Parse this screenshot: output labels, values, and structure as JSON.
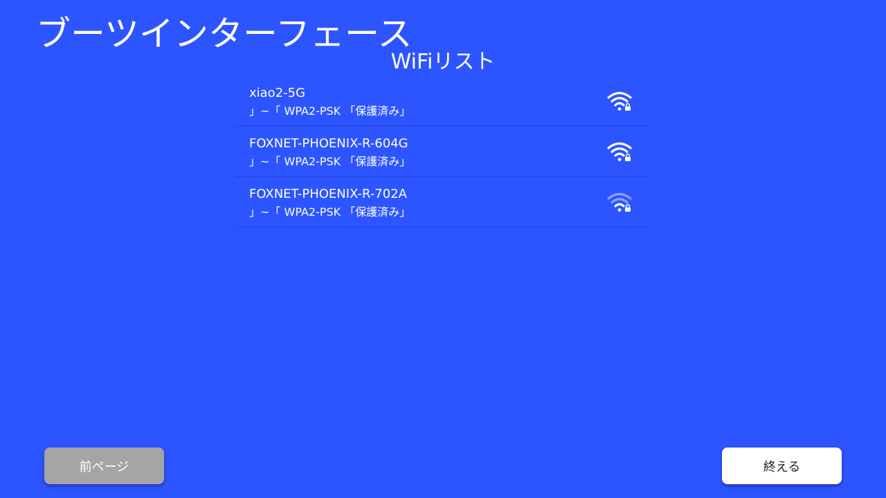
{
  "header": {
    "title": "ブーツインターフェース"
  },
  "wifi_section": {
    "title": "WiFiリスト"
  },
  "networks": [
    {
      "ssid": "xiao2-5G",
      "security": "」~「 WPA2-PSK 「保護済み」",
      "signal_icon": "wifi-signal-full-lock-icon",
      "signal_level": 1.0
    },
    {
      "ssid": "FOXNET-PHOENIX-R-604G",
      "security": "」~「 WPA2-PSK 「保護済み」",
      "signal_icon": "wifi-signal-full-lock-icon",
      "signal_level": 1.0
    },
    {
      "ssid": "FOXNET-PHOENIX-R-702A",
      "security": "」~「 WPA2-PSK 「保護済み」",
      "signal_icon": "wifi-signal-weak-lock-icon",
      "signal_level": 0.5
    }
  ],
  "footer": {
    "prev_label": "前ページ",
    "finish_label": "終える"
  },
  "colors": {
    "background": "#2d55ff",
    "prev_button": "#a5a5a5",
    "finish_button": "#ffffff"
  }
}
